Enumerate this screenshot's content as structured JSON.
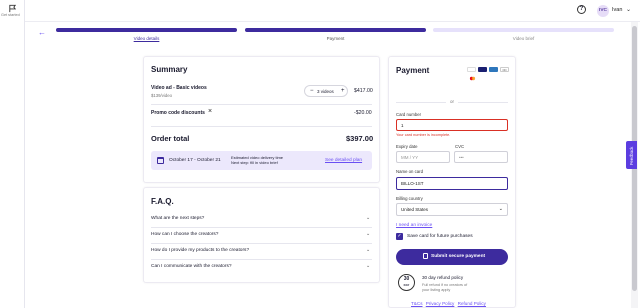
{
  "rail": {
    "label": "Get started"
  },
  "header": {
    "user_initials": "IVC",
    "user_name": "Ivan"
  },
  "steps": [
    {
      "label": "Video details"
    },
    {
      "label": "Payment"
    },
    {
      "label": "Video brief"
    }
  ],
  "summary": {
    "title": "Summary",
    "item_name": "Video ad - Basic videos",
    "item_unit_price": "$139/video",
    "quantity_label": "3 videos",
    "item_price": "$417.00",
    "promo_label": "Promo code discounts",
    "promo_value": "-$20.00",
    "total_label": "Order total",
    "total_value": "$397.00",
    "delivery_dates": "October 17 - October 21",
    "delivery_estimate_line1": "Estimated video delivery time",
    "delivery_estimate_line2": "Next step: fill in video brief",
    "detailed_plan_link": "See detailed plan"
  },
  "faq": {
    "title": "F.A.Q.",
    "questions": [
      "What are the next steps?",
      "How can I choose the creators?",
      "How do I provide my products to the creators?",
      "Can I communicate with the creators?"
    ]
  },
  "payment": {
    "title": "Payment",
    "or_label": "or",
    "card_number_label": "Card number",
    "card_number_value": "1",
    "card_number_error": "Your card number is incomplete.",
    "expiry_label": "Expiry date",
    "expiry_placeholder": "MM / YY",
    "cvc_label": "CVC",
    "cvc_placeholder": "•••",
    "name_label": "Name on card",
    "name_value": "BILLO-1ST",
    "country_label": "Billing country",
    "country_value": "United States",
    "invoice_link": "I need an invoice",
    "save_card_label": "Save card for future purchases",
    "submit_label": "Submit secure payment",
    "refund_badge_number": "30",
    "refund_badge_unit": "DAY",
    "refund_title": "30 day refund policy",
    "refund_text_line1": "Full refund if no creators of",
    "refund_text_line2": "your listing apply",
    "links": [
      "T&Cs",
      "Privacy Policy",
      "Refund Policy"
    ]
  },
  "feedback_tab": "Feedback",
  "colors": {
    "accent": "#3d2b9e",
    "link": "#6a4ff3",
    "error": "#d93025",
    "highlight_bg": "#ece8fc"
  }
}
